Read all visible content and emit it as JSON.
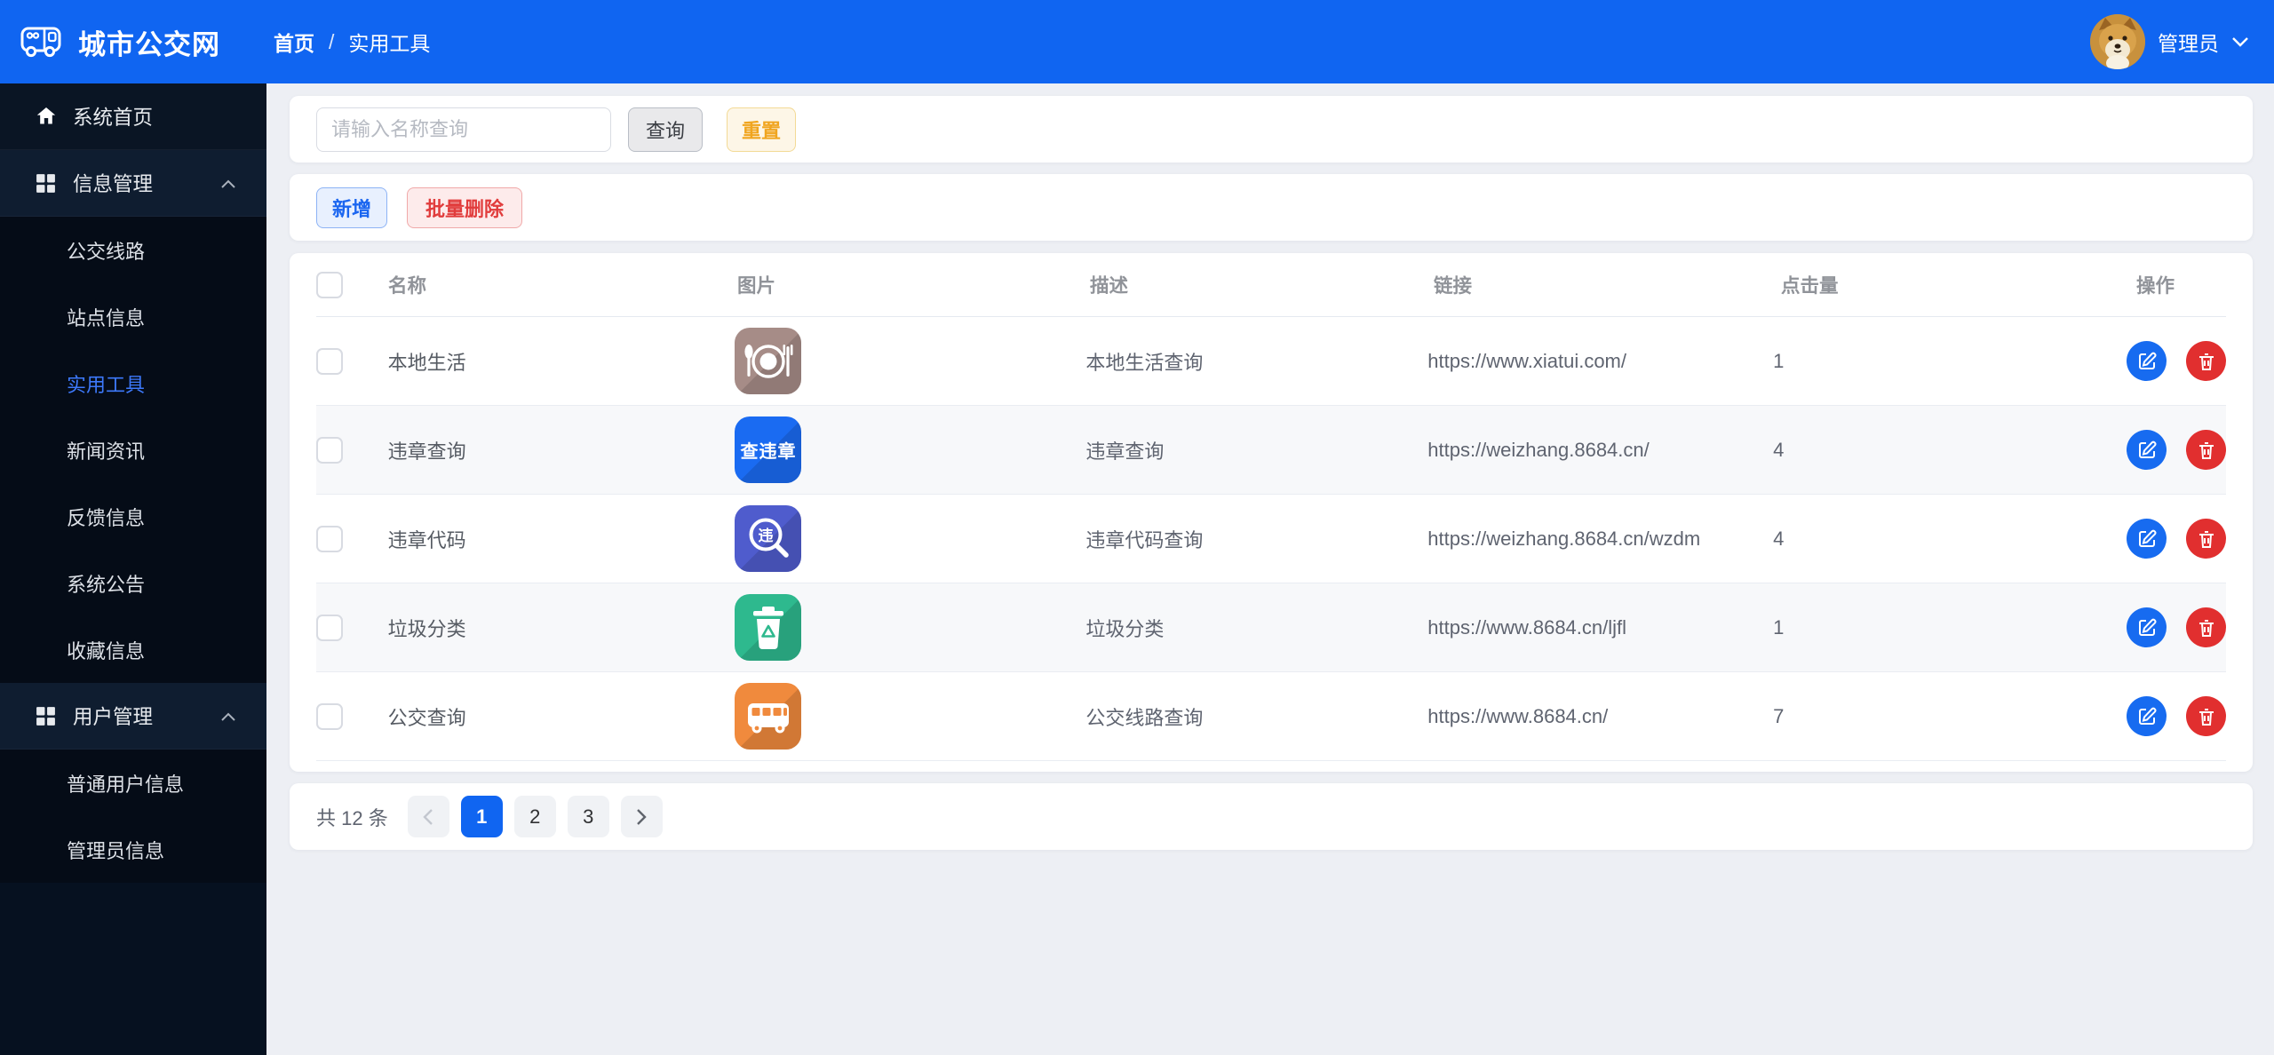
{
  "theme": {
    "accent": "#1065f1",
    "danger": "#e12f2f",
    "warning": "#f0a51f",
    "sidebar_bg": "#061120",
    "active_link": "#3d79fb"
  },
  "header": {
    "brand": "城市公交网",
    "breadcrumb": {
      "items": [
        "首页",
        "实用工具"
      ],
      "separator": "/"
    },
    "user_name": "管理员"
  },
  "sidebar": {
    "home": {
      "label": "系统首页"
    },
    "group_info": {
      "label": "信息管理"
    },
    "info_items": [
      {
        "label": "公交线路"
      },
      {
        "label": "站点信息"
      },
      {
        "label": "实用工具",
        "active": true
      },
      {
        "label": "新闻资讯"
      },
      {
        "label": "反馈信息"
      },
      {
        "label": "系统公告"
      },
      {
        "label": "收藏信息"
      }
    ],
    "group_user": {
      "label": "用户管理"
    },
    "user_items": [
      {
        "label": "普通用户信息"
      },
      {
        "label": "管理员信息"
      }
    ]
  },
  "search": {
    "placeholder": "请输入名称查询",
    "query_label": "查询",
    "reset_label": "重置"
  },
  "toolbar": {
    "add_label": "新增",
    "batch_delete_label": "批量删除"
  },
  "table": {
    "columns": [
      "名称",
      "图片",
      "描述",
      "链接",
      "点击量",
      "操作"
    ],
    "rows": [
      {
        "name": "本地生活",
        "icon": {
          "kind": "dining-icon",
          "color": "#a68c87"
        },
        "desc": "本地生活查询",
        "link": "https://www.xiatui.com/",
        "clicks": "1"
      },
      {
        "name": "违章查询",
        "icon": {
          "kind": "violation-query-icon",
          "color": "#1a6bf2",
          "text": "查违章"
        },
        "desc": "违章查询",
        "link": "https://weizhang.8684.cn/",
        "clicks": "4"
      },
      {
        "name": "违章代码",
        "icon": {
          "kind": "violation-code-magnifier-icon",
          "color": "#4f5ccd",
          "text": "违"
        },
        "desc": "违章代码查询",
        "link": "https://weizhang.8684.cn/wzdm",
        "clicks": "4"
      },
      {
        "name": "垃圾分类",
        "icon": {
          "kind": "recycle-trash-icon",
          "color": "#2eb98e"
        },
        "desc": "垃圾分类",
        "link": "https://www.8684.cn/ljfl",
        "clicks": "1"
      },
      {
        "name": "公交查询",
        "icon": {
          "kind": "bus-icon",
          "color": "#f08a3d"
        },
        "desc": "公交线路查询",
        "link": "https://www.8684.cn/",
        "clicks": "7"
      }
    ]
  },
  "pagination": {
    "total_label": "共 12 条",
    "pages": [
      "1",
      "2",
      "3"
    ],
    "active_page": "1"
  }
}
